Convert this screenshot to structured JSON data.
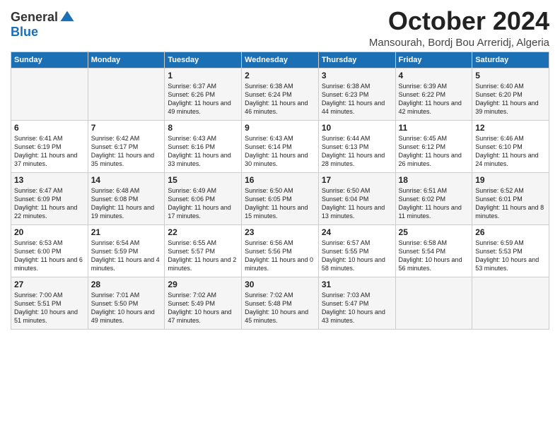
{
  "header": {
    "logo_line1": "General",
    "logo_line2": "Blue",
    "month": "October 2024",
    "location": "Mansourah, Bordj Bou Arreridj, Algeria"
  },
  "days_of_week": [
    "Sunday",
    "Monday",
    "Tuesday",
    "Wednesday",
    "Thursday",
    "Friday",
    "Saturday"
  ],
  "weeks": [
    [
      {
        "day": "",
        "info": ""
      },
      {
        "day": "",
        "info": ""
      },
      {
        "day": "1",
        "info": "Sunrise: 6:37 AM\nSunset: 6:26 PM\nDaylight: 11 hours and 49 minutes."
      },
      {
        "day": "2",
        "info": "Sunrise: 6:38 AM\nSunset: 6:24 PM\nDaylight: 11 hours and 46 minutes."
      },
      {
        "day": "3",
        "info": "Sunrise: 6:38 AM\nSunset: 6:23 PM\nDaylight: 11 hours and 44 minutes."
      },
      {
        "day": "4",
        "info": "Sunrise: 6:39 AM\nSunset: 6:22 PM\nDaylight: 11 hours and 42 minutes."
      },
      {
        "day": "5",
        "info": "Sunrise: 6:40 AM\nSunset: 6:20 PM\nDaylight: 11 hours and 39 minutes."
      }
    ],
    [
      {
        "day": "6",
        "info": "Sunrise: 6:41 AM\nSunset: 6:19 PM\nDaylight: 11 hours and 37 minutes."
      },
      {
        "day": "7",
        "info": "Sunrise: 6:42 AM\nSunset: 6:17 PM\nDaylight: 11 hours and 35 minutes."
      },
      {
        "day": "8",
        "info": "Sunrise: 6:43 AM\nSunset: 6:16 PM\nDaylight: 11 hours and 33 minutes."
      },
      {
        "day": "9",
        "info": "Sunrise: 6:43 AM\nSunset: 6:14 PM\nDaylight: 11 hours and 30 minutes."
      },
      {
        "day": "10",
        "info": "Sunrise: 6:44 AM\nSunset: 6:13 PM\nDaylight: 11 hours and 28 minutes."
      },
      {
        "day": "11",
        "info": "Sunrise: 6:45 AM\nSunset: 6:12 PM\nDaylight: 11 hours and 26 minutes."
      },
      {
        "day": "12",
        "info": "Sunrise: 6:46 AM\nSunset: 6:10 PM\nDaylight: 11 hours and 24 minutes."
      }
    ],
    [
      {
        "day": "13",
        "info": "Sunrise: 6:47 AM\nSunset: 6:09 PM\nDaylight: 11 hours and 22 minutes."
      },
      {
        "day": "14",
        "info": "Sunrise: 6:48 AM\nSunset: 6:08 PM\nDaylight: 11 hours and 19 minutes."
      },
      {
        "day": "15",
        "info": "Sunrise: 6:49 AM\nSunset: 6:06 PM\nDaylight: 11 hours and 17 minutes."
      },
      {
        "day": "16",
        "info": "Sunrise: 6:50 AM\nSunset: 6:05 PM\nDaylight: 11 hours and 15 minutes."
      },
      {
        "day": "17",
        "info": "Sunrise: 6:50 AM\nSunset: 6:04 PM\nDaylight: 11 hours and 13 minutes."
      },
      {
        "day": "18",
        "info": "Sunrise: 6:51 AM\nSunset: 6:02 PM\nDaylight: 11 hours and 11 minutes."
      },
      {
        "day": "19",
        "info": "Sunrise: 6:52 AM\nSunset: 6:01 PM\nDaylight: 11 hours and 8 minutes."
      }
    ],
    [
      {
        "day": "20",
        "info": "Sunrise: 6:53 AM\nSunset: 6:00 PM\nDaylight: 11 hours and 6 minutes."
      },
      {
        "day": "21",
        "info": "Sunrise: 6:54 AM\nSunset: 5:59 PM\nDaylight: 11 hours and 4 minutes."
      },
      {
        "day": "22",
        "info": "Sunrise: 6:55 AM\nSunset: 5:57 PM\nDaylight: 11 hours and 2 minutes."
      },
      {
        "day": "23",
        "info": "Sunrise: 6:56 AM\nSunset: 5:56 PM\nDaylight: 11 hours and 0 minutes."
      },
      {
        "day": "24",
        "info": "Sunrise: 6:57 AM\nSunset: 5:55 PM\nDaylight: 10 hours and 58 minutes."
      },
      {
        "day": "25",
        "info": "Sunrise: 6:58 AM\nSunset: 5:54 PM\nDaylight: 10 hours and 56 minutes."
      },
      {
        "day": "26",
        "info": "Sunrise: 6:59 AM\nSunset: 5:53 PM\nDaylight: 10 hours and 53 minutes."
      }
    ],
    [
      {
        "day": "27",
        "info": "Sunrise: 7:00 AM\nSunset: 5:51 PM\nDaylight: 10 hours and 51 minutes."
      },
      {
        "day": "28",
        "info": "Sunrise: 7:01 AM\nSunset: 5:50 PM\nDaylight: 10 hours and 49 minutes."
      },
      {
        "day": "29",
        "info": "Sunrise: 7:02 AM\nSunset: 5:49 PM\nDaylight: 10 hours and 47 minutes."
      },
      {
        "day": "30",
        "info": "Sunrise: 7:02 AM\nSunset: 5:48 PM\nDaylight: 10 hours and 45 minutes."
      },
      {
        "day": "31",
        "info": "Sunrise: 7:03 AM\nSunset: 5:47 PM\nDaylight: 10 hours and 43 minutes."
      },
      {
        "day": "",
        "info": ""
      },
      {
        "day": "",
        "info": ""
      }
    ]
  ]
}
